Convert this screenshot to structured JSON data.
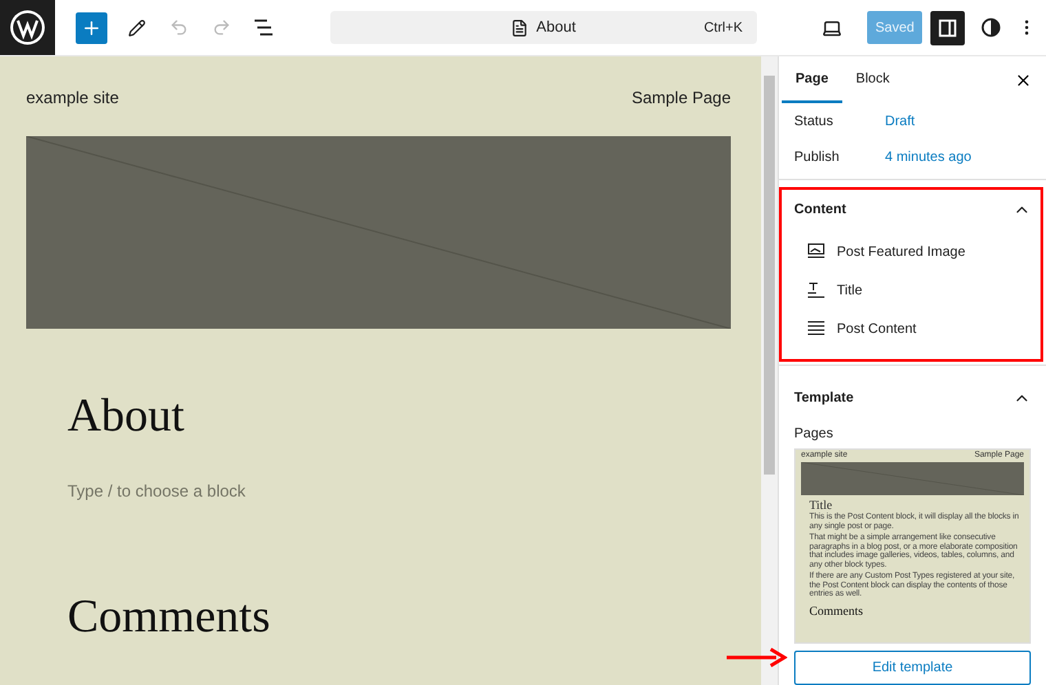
{
  "toolbar": {
    "document_title": "About",
    "shortcut": "Ctrl+K",
    "save_label": "Saved"
  },
  "canvas": {
    "site_title": "example site",
    "nav_link": "Sample Page",
    "page_title": "About",
    "block_placeholder": "Type / to choose a block",
    "comments_heading": "Comments"
  },
  "sidebar": {
    "tabs": [
      {
        "label": "Page",
        "selected": true
      },
      {
        "label": "Block",
        "selected": false
      }
    ],
    "fields": [
      {
        "label": "Status",
        "value": "Draft"
      },
      {
        "label": "Publish",
        "value": "4 minutes ago"
      }
    ],
    "content_panel": {
      "title": "Content",
      "expanded": true,
      "items": [
        {
          "kind": "image",
          "label": "Post Featured Image"
        },
        {
          "kind": "title",
          "label": "Title"
        },
        {
          "kind": "content",
          "label": "Post Content"
        }
      ]
    },
    "template_panel": {
      "title": "Template",
      "expanded": true,
      "template_name": "Pages",
      "preview": {
        "site_title": "example site",
        "nav_link": "Sample Page",
        "title": "Title",
        "paragraphs": [
          "This is the Post Content block, it will display all the blocks in any single post or page.",
          "That might be a simple arrangement like consecutive paragraphs in a blog post, or a more elaborate composition that includes image galleries, videos, tables, columns, and any other block types.",
          "If there are any Custom Post Types registered at your site, the Post Content block can display the contents of those entries as well."
        ],
        "comments_heading": "Comments"
      },
      "button": "Edit template"
    }
  }
}
